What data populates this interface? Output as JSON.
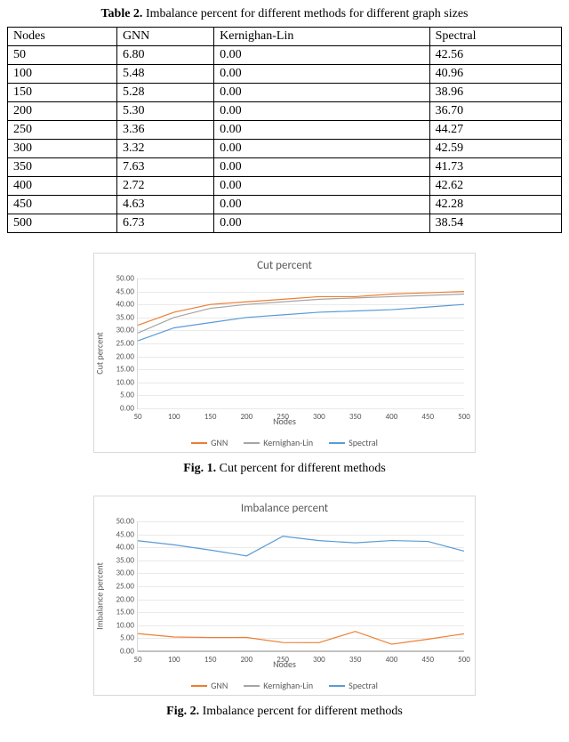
{
  "table": {
    "caption_label": "Table 2.",
    "caption_text": " Imbalance percent for different methods for different graph sizes",
    "headers": [
      "Nodes",
      "GNN",
      "Kernighan-Lin",
      "Spectral"
    ],
    "rows": [
      [
        "50",
        "6.80",
        "0.00",
        "42.56"
      ],
      [
        "100",
        "5.48",
        "0.00",
        "40.96"
      ],
      [
        "150",
        "5.28",
        "0.00",
        "38.96"
      ],
      [
        "200",
        "5.30",
        "0.00",
        "36.70"
      ],
      [
        "250",
        "3.36",
        "0.00",
        "44.27"
      ],
      [
        "300",
        "3.32",
        "0.00",
        "42.59"
      ],
      [
        "350",
        "7.63",
        "0.00",
        "41.73"
      ],
      [
        "400",
        "2.72",
        "0.00",
        "42.62"
      ],
      [
        "450",
        "4.63",
        "0.00",
        "42.28"
      ],
      [
        "500",
        "6.73",
        "0.00",
        "38.54"
      ]
    ]
  },
  "fig1": {
    "caption_label": "Fig. 1.",
    "caption_text": "  Cut percent for different methods"
  },
  "fig2": {
    "caption_label": "Fig. 2.",
    "caption_text": " Imbalance percent for different methods"
  },
  "colors": {
    "gnn": "#ed7d31",
    "kl": "#a5a5a5",
    "spectral": "#5b9bd5"
  },
  "chart_data": [
    {
      "type": "line",
      "title": "Cut percent",
      "xlabel": "Nodes",
      "ylabel": "Cut percent",
      "ylim": [
        0,
        50
      ],
      "yticks": [
        0,
        5,
        10,
        15,
        20,
        25,
        30,
        35,
        40,
        45,
        50
      ],
      "categories": [
        50,
        100,
        150,
        200,
        250,
        300,
        350,
        400,
        450,
        500
      ],
      "legend": [
        "GNN",
        "Kernighan-Lin",
        "Spectral"
      ],
      "series": [
        {
          "name": "GNN",
          "color": "#ed7d31",
          "values": [
            32.0,
            37.0,
            40.0,
            41.0,
            42.0,
            43.0,
            43.0,
            44.0,
            44.5,
            45.0
          ]
        },
        {
          "name": "Kernighan-Lin",
          "color": "#a5a5a5",
          "values": [
            29.0,
            35.0,
            38.5,
            40.0,
            41.0,
            42.0,
            42.5,
            43.0,
            43.5,
            44.0
          ]
        },
        {
          "name": "Spectral",
          "color": "#5b9bd5",
          "values": [
            26.0,
            31.0,
            33.0,
            35.0,
            36.0,
            37.0,
            37.5,
            38.0,
            39.0,
            40.0
          ]
        }
      ]
    },
    {
      "type": "line",
      "title": "Imbalance percent",
      "xlabel": "Nodes",
      "ylabel": "Imbalance percent",
      "ylim": [
        0,
        50
      ],
      "yticks": [
        0,
        5,
        10,
        15,
        20,
        25,
        30,
        35,
        40,
        45,
        50
      ],
      "categories": [
        50,
        100,
        150,
        200,
        250,
        300,
        350,
        400,
        450,
        500
      ],
      "legend": [
        "GNN",
        "Kernighan-Lin",
        "Spectral"
      ],
      "series": [
        {
          "name": "GNN",
          "color": "#ed7d31",
          "values": [
            6.8,
            5.48,
            5.28,
            5.3,
            3.36,
            3.32,
            7.63,
            2.72,
            4.63,
            6.73
          ]
        },
        {
          "name": "Kernighan-Lin",
          "color": "#a5a5a5",
          "values": [
            0.0,
            0.0,
            0.0,
            0.0,
            0.0,
            0.0,
            0.0,
            0.0,
            0.0,
            0.0
          ]
        },
        {
          "name": "Spectral",
          "color": "#5b9bd5",
          "values": [
            42.56,
            40.96,
            38.96,
            36.7,
            44.27,
            42.59,
            41.73,
            42.62,
            42.28,
            38.54
          ]
        }
      ]
    }
  ]
}
